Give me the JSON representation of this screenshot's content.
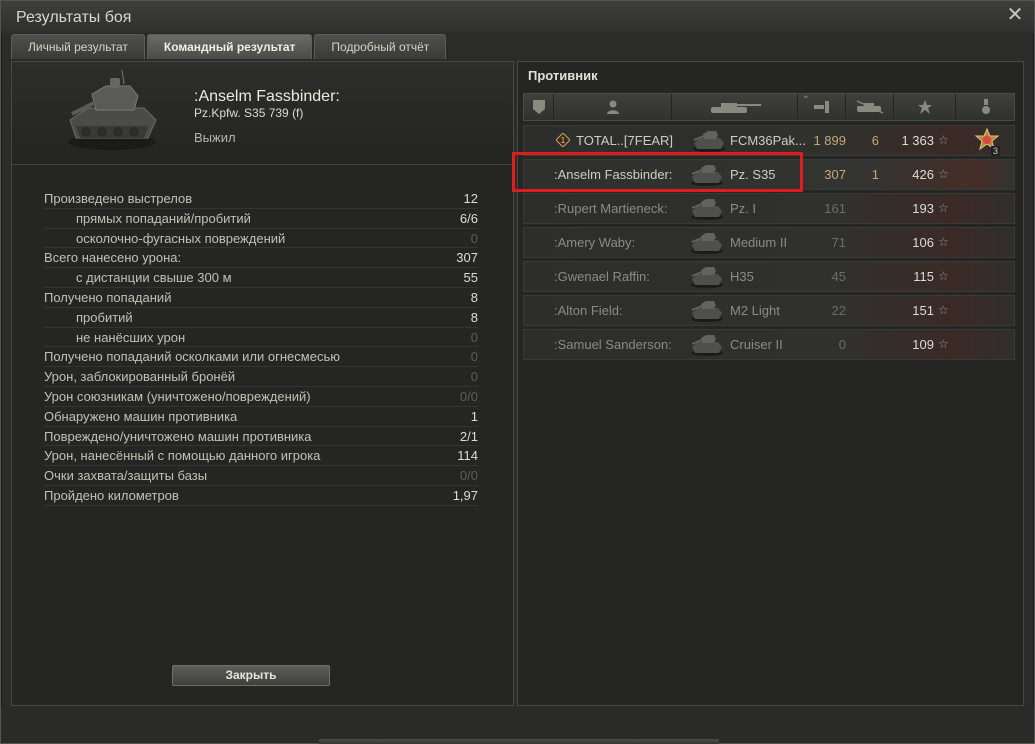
{
  "window": {
    "title": "Результаты боя"
  },
  "tabs": [
    {
      "label": "Личный результат",
      "active": false
    },
    {
      "label": "Командный результат",
      "active": true
    },
    {
      "label": "Подробный отчёт",
      "active": false
    }
  ],
  "player": {
    "name": ":Anselm Fassbinder:",
    "vehicle": "Pz.Kpfw. S35 739 (f)",
    "status": "Выжил"
  },
  "stats": [
    {
      "label": "Произведено выстрелов",
      "value": "12",
      "sub": false,
      "dim": false
    },
    {
      "label": "прямых попаданий/пробитий",
      "value": "6/6",
      "sub": true,
      "dim": false
    },
    {
      "label": "осколочно-фугасных повреждений",
      "value": "0",
      "sub": true,
      "dim": true
    },
    {
      "label": "Всего нанесено урона:",
      "value": "307",
      "sub": false,
      "dim": false
    },
    {
      "label": "с дистанции свыше 300 м",
      "value": "55",
      "sub": true,
      "dim": false
    },
    {
      "label": "Получено попаданий",
      "value": "8",
      "sub": false,
      "dim": false
    },
    {
      "label": "пробитий",
      "value": "8",
      "sub": true,
      "dim": false
    },
    {
      "label": "не нанёсших урон",
      "value": "0",
      "sub": true,
      "dim": true
    },
    {
      "label": "Получено попаданий осколками или огнесмесью",
      "value": "0",
      "sub": false,
      "dim": true
    },
    {
      "label": "Урон, заблокированный бронёй",
      "value": "0",
      "sub": false,
      "dim": true
    },
    {
      "label": "Урон союзникам (уничтожено/повреждений)",
      "value": "0/0",
      "sub": false,
      "dim": true
    },
    {
      "label": "Обнаружено машин противника",
      "value": "1",
      "sub": false,
      "dim": false
    },
    {
      "label": "Повреждено/уничтожено машин противника",
      "value": "2/1",
      "sub": false,
      "dim": false
    },
    {
      "label": "Урон, нанесённый с помощью данного игрока",
      "value": "114",
      "sub": false,
      "dim": false
    },
    {
      "label": "Очки захвата/защиты базы",
      "value": "0/0",
      "sub": false,
      "dim": true
    },
    {
      "label": "Пройдено километров",
      "value": "1,97",
      "sub": false,
      "dim": false
    }
  ],
  "buttons": {
    "close": "Закрыть"
  },
  "enemy_team": {
    "title": "Противник",
    "columns": [
      "squad-icon",
      "player-icon",
      "vehicle-icon",
      "damage-icon",
      "kills-icon",
      "xp-star-icon",
      "medal-icon"
    ],
    "rows": [
      {
        "name": "TOTAL..[7FEAR]",
        "vehicle": "FCM36Pak...",
        "damage": "1 899",
        "kills": "6",
        "xp": "1 363",
        "alive": true,
        "platoon_badge": true,
        "medal": true,
        "medal_count": "3"
      },
      {
        "name": ":Anselm Fassbinder:",
        "vehicle": "Pz. S35",
        "damage": "307",
        "kills": "1",
        "xp": "426",
        "alive": true,
        "platoon_badge": false,
        "medal": false,
        "highlight": true
      },
      {
        "name": ":Rupert Martieneck:",
        "vehicle": "Pz. I",
        "damage": "161",
        "kills": "",
        "xp": "193",
        "alive": false,
        "platoon_badge": false,
        "medal": false
      },
      {
        "name": ":Amery Waby:",
        "vehicle": "Medium II",
        "damage": "71",
        "kills": "",
        "xp": "106",
        "alive": false,
        "platoon_badge": false,
        "medal": false
      },
      {
        "name": ":Gwenael Raffin:",
        "vehicle": "H35",
        "damage": "45",
        "kills": "",
        "xp": "115",
        "alive": false,
        "platoon_badge": false,
        "medal": false
      },
      {
        "name": ":Alton Field:",
        "vehicle": "M2 Light",
        "damage": "22",
        "kills": "",
        "xp": "151",
        "alive": false,
        "platoon_badge": false,
        "medal": false
      },
      {
        "name": ":Samuel Sanderson:",
        "vehicle": "Cruiser II",
        "damage": "0",
        "kills": "",
        "xp": "109",
        "alive": false,
        "platoon_badge": false,
        "medal": false
      }
    ]
  },
  "colors": {
    "highlight_border": "#e01c1c",
    "damage_text": "#c9a676"
  }
}
